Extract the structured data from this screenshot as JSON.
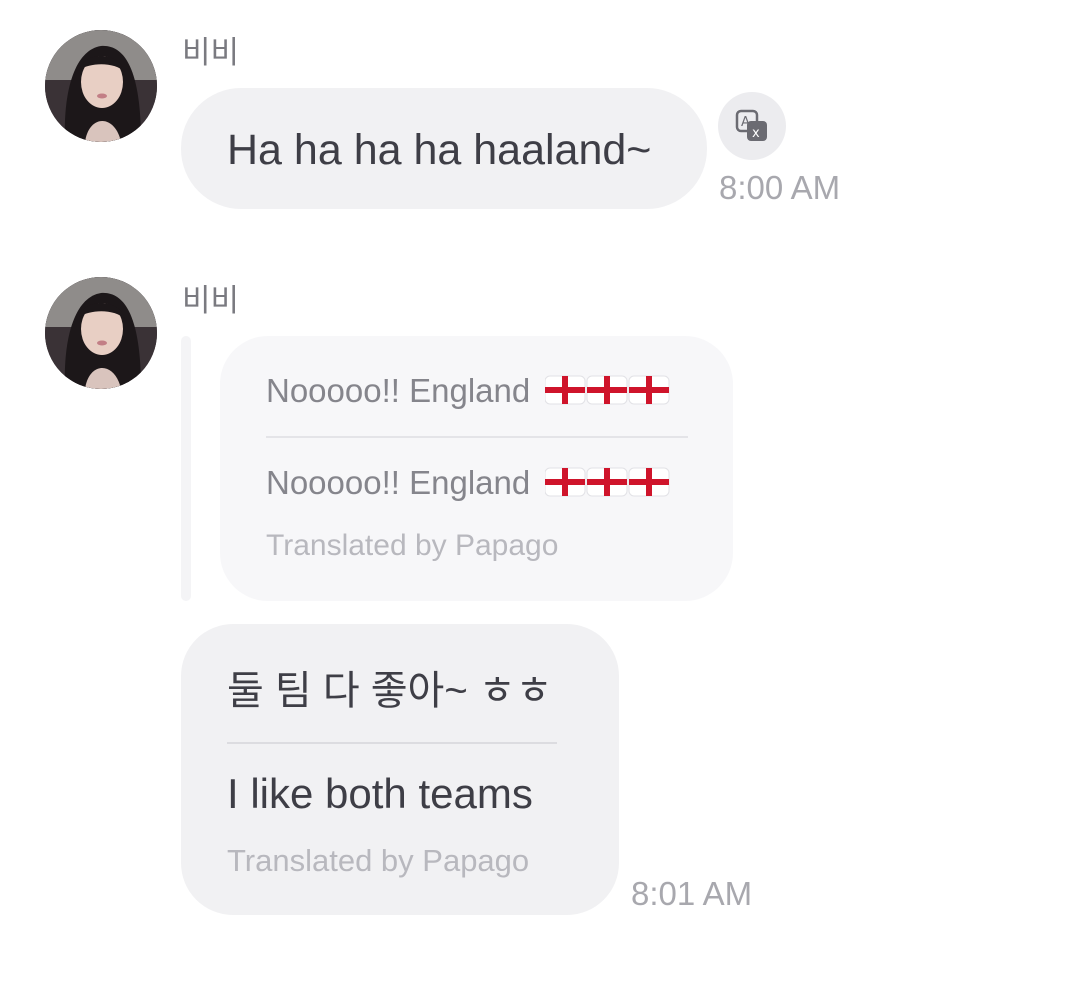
{
  "messages": [
    {
      "sender": "비비",
      "text": "Ha ha ha ha haaland~",
      "time": "8:00 AM",
      "translate_icon": "translate-icon"
    },
    {
      "sender": "비비",
      "quoted": {
        "original": "Nooooo!! England",
        "translated": "Nooooo!! England",
        "flag_icon": "england-flag-icon",
        "flag_count": 3,
        "credit": "Translated by Papago"
      },
      "original": "둘 팀 다 좋아~ ㅎㅎ",
      "translated": "I like both teams",
      "credit": "Translated by Papago",
      "time": "8:01 AM"
    }
  ],
  "colors": {
    "bubble": "#f1f1f3",
    "quoted_bubble": "#f7f7f9",
    "text": "#3e3e46",
    "muted": "#a8a8ae",
    "flag_red": "#cf142b"
  }
}
